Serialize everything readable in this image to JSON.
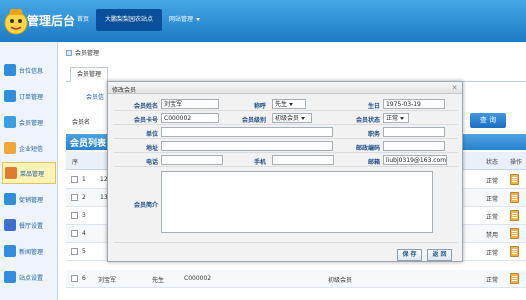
{
  "header": {
    "title": "管理后台",
    "nav": [
      {
        "label": "首页"
      },
      {
        "label": "大鹏梨梨园农站点"
      },
      {
        "label": "网站管理"
      }
    ]
  },
  "sidebar": {
    "items": [
      {
        "label": "台位信息",
        "icon": "table-icon",
        "color": "#2f8fd8"
      },
      {
        "label": "订单管理",
        "icon": "order-icon",
        "color": "#2f8fd8"
      },
      {
        "label": "会员管理",
        "icon": "member-icon",
        "color": "#3aa0e0"
      },
      {
        "label": "企业短信",
        "icon": "sms-icon",
        "color": "#f0a73a"
      },
      {
        "label": "菜品管理",
        "icon": "dish-icon",
        "color": "#e07a2f"
      },
      {
        "label": "促销管理",
        "icon": "promo-icon",
        "color": "#2f8fd8"
      },
      {
        "label": "餐厅设置",
        "icon": "restaurant-icon",
        "color": "#3f6fd0"
      },
      {
        "label": "新闻管理",
        "icon": "news-icon",
        "color": "#2f8fd8"
      },
      {
        "label": "站点设置",
        "icon": "site-icon",
        "color": "#2f8fd8"
      }
    ]
  },
  "main": {
    "title": "会员管理",
    "tab": "会员管理",
    "sub_link": "会员信",
    "search_label": "会员名",
    "query_button": "查 询",
    "list_title": "会员列表",
    "table_headers": {
      "seq": "序",
      "status": "状态",
      "action": "操作"
    },
    "rows": [
      {
        "seq": "1",
        "c2": "12",
        "name": "",
        "gender": "",
        "card": "",
        "level": "",
        "status": "正常"
      },
      {
        "seq": "2",
        "c2": "13",
        "name": "",
        "gender": "",
        "card": "",
        "level": "",
        "status": "正常"
      },
      {
        "seq": "3",
        "c2": "",
        "name": "",
        "gender": "",
        "card": "",
        "level": "",
        "status": "正常"
      },
      {
        "seq": "4",
        "c2": "",
        "name": "",
        "gender": "",
        "card": "",
        "level": "",
        "status": "禁用"
      },
      {
        "seq": "5",
        "c2": "",
        "name": "",
        "gender": "",
        "card": "",
        "level": "",
        "status": "正常"
      },
      {
        "seq": "6",
        "c2": "",
        "name": "刘宝军",
        "gender": "先生",
        "card": "C000002",
        "level": "初级会员",
        "status": "正常"
      }
    ]
  },
  "modal": {
    "title": "修改会员",
    "close_icon": "close-icon",
    "fields": {
      "name_label": "会员姓名",
      "name_value": "刘宝军",
      "title_label": "称呼",
      "title_value": "先生",
      "birthday_label": "生日",
      "birthday_value": "1975-03-19",
      "card_label": "会员卡号",
      "card_value": "C000002",
      "level_label": "会员级别",
      "level_value": "初级会员",
      "status_label": "会员状态",
      "status_value": "正常",
      "company_label": "单位",
      "job_label": "职务",
      "address_label": "地址",
      "zip_label": "邮政编码",
      "phone_label": "电话",
      "mobile_label": "手机",
      "email_label": "邮箱",
      "email_value": "liubj0319@163.com",
      "intro_label": "会员简介"
    },
    "save_button": "保 存",
    "back_button": "返 回"
  }
}
